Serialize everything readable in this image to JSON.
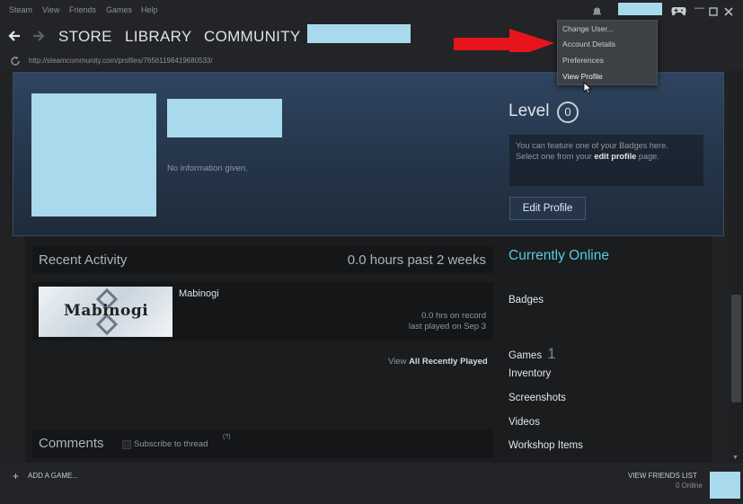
{
  "menubar": {
    "items": [
      "Steam",
      "View",
      "Friends",
      "Games",
      "Help"
    ]
  },
  "nav": {
    "store": "STORE",
    "library": "LIBRARY",
    "community": "COMMUNITY",
    "url": "http://steamcommunity.com/profiles/76561198419680533/"
  },
  "dropdown": {
    "items": [
      "Change User...",
      "Account Details",
      "Preferences",
      "View Profile"
    ]
  },
  "profile": {
    "summary": "No information given.",
    "level_label": "Level",
    "level_value": "0",
    "badge_hint_1": "You can feature one of your Badges here.",
    "badge_hint_2_pre": "Select one from your ",
    "badge_hint_2_link": "edit profile",
    "badge_hint_2_post": " page.",
    "edit_button": "Edit Profile"
  },
  "activity": {
    "title": "Recent Activity",
    "hours": "0.0 hours past 2 weeks",
    "game_name": "Mabinogi",
    "game_logo_text": "Mabinogi",
    "game_hours": "0.0 hrs on record",
    "game_last_played": "last played on Sep 3",
    "view_all_pre": "View ",
    "view_all_link": "All Recently Played"
  },
  "comments": {
    "title": "Comments",
    "subscribe": "Subscribe to thread",
    "help": "(?)"
  },
  "sidebar": {
    "status": "Currently Online",
    "badges": "Badges",
    "games": "Games",
    "games_count": "1",
    "inventory": "Inventory",
    "screenshots": "Screenshots",
    "videos": "Videos",
    "workshop": "Workshop Items"
  },
  "bottom": {
    "add_game": "ADD A GAME...",
    "friends_list": "VIEW FRIENDS LIST",
    "online": "0 Online"
  },
  "colors": {
    "accent_online": "#57cbde",
    "redaction": "#a8d9ec",
    "arrow": "#e8141b"
  }
}
